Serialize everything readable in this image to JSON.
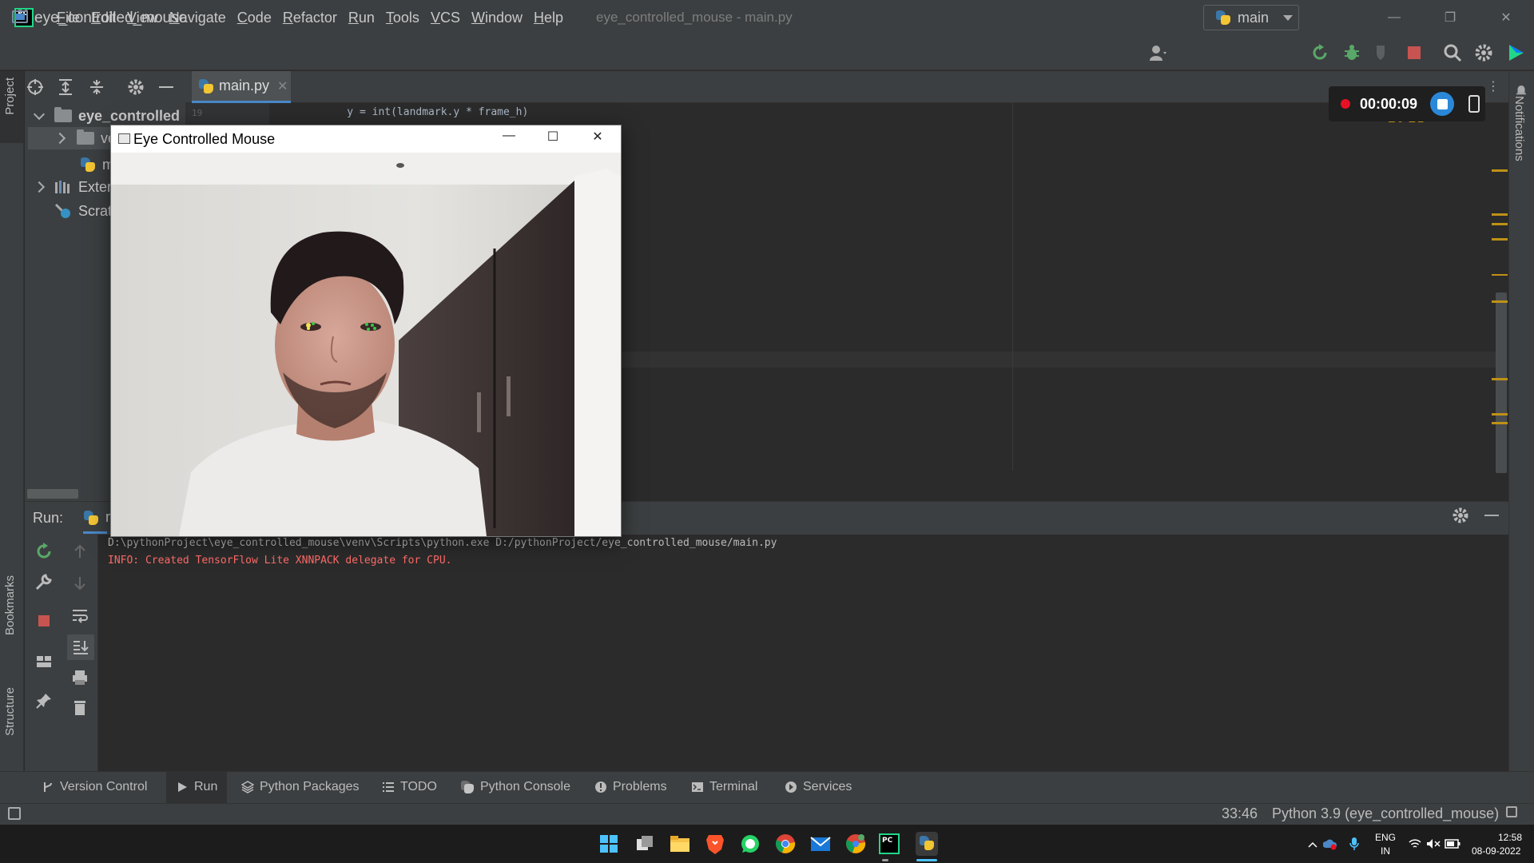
{
  "menu": [
    "File",
    "Edit",
    "View",
    "Navigate",
    "Code",
    "Refactor",
    "Run",
    "Tools",
    "VCS",
    "Window",
    "Help"
  ],
  "window_title": "eye_controlled_mouse - main.py",
  "navbar": {
    "project": "eye_controlled_mouse",
    "run_config": "main"
  },
  "left_strip": {
    "project": "Project",
    "bookmarks": "Bookmarks",
    "structure": "Structure"
  },
  "right_strip": {
    "notifications": "Notifications"
  },
  "project_tree": {
    "root": "eye_controlled",
    "venv": "ve",
    "main": "m",
    "external": "Exter",
    "scratches": "Scrat"
  },
  "editor": {
    "tab": "main.py",
    "line_number": "19",
    "code_line": "    y = int(landmark.y * frame_h)",
    "inspections": "▲9 ▲2"
  },
  "recording": {
    "time": "00:00:09"
  },
  "camera_window": {
    "title": "Eye Controlled Mouse"
  },
  "run_panel": {
    "label": "Run:",
    "tab": "m",
    "console": [
      "D:\\pythonProject\\eye_controlled_mouse\\venv\\Scripts\\python.exe D:/pythonProject/eye_controlled_mouse/main.py",
      "INFO: Created TensorFlow Lite XNNPACK delegate for CPU."
    ]
  },
  "bottom_tabs": [
    "Version Control",
    "Run",
    "Python Packages",
    "TODO",
    "Python Console",
    "Problems",
    "Terminal",
    "Services"
  ],
  "status": {
    "position": "33:46",
    "interpreter": "Python 3.9 (eye_controlled_mouse)"
  },
  "tray": {
    "lang": "ENG",
    "region": "IN",
    "time": "12:58",
    "date": "08-09-2022"
  }
}
